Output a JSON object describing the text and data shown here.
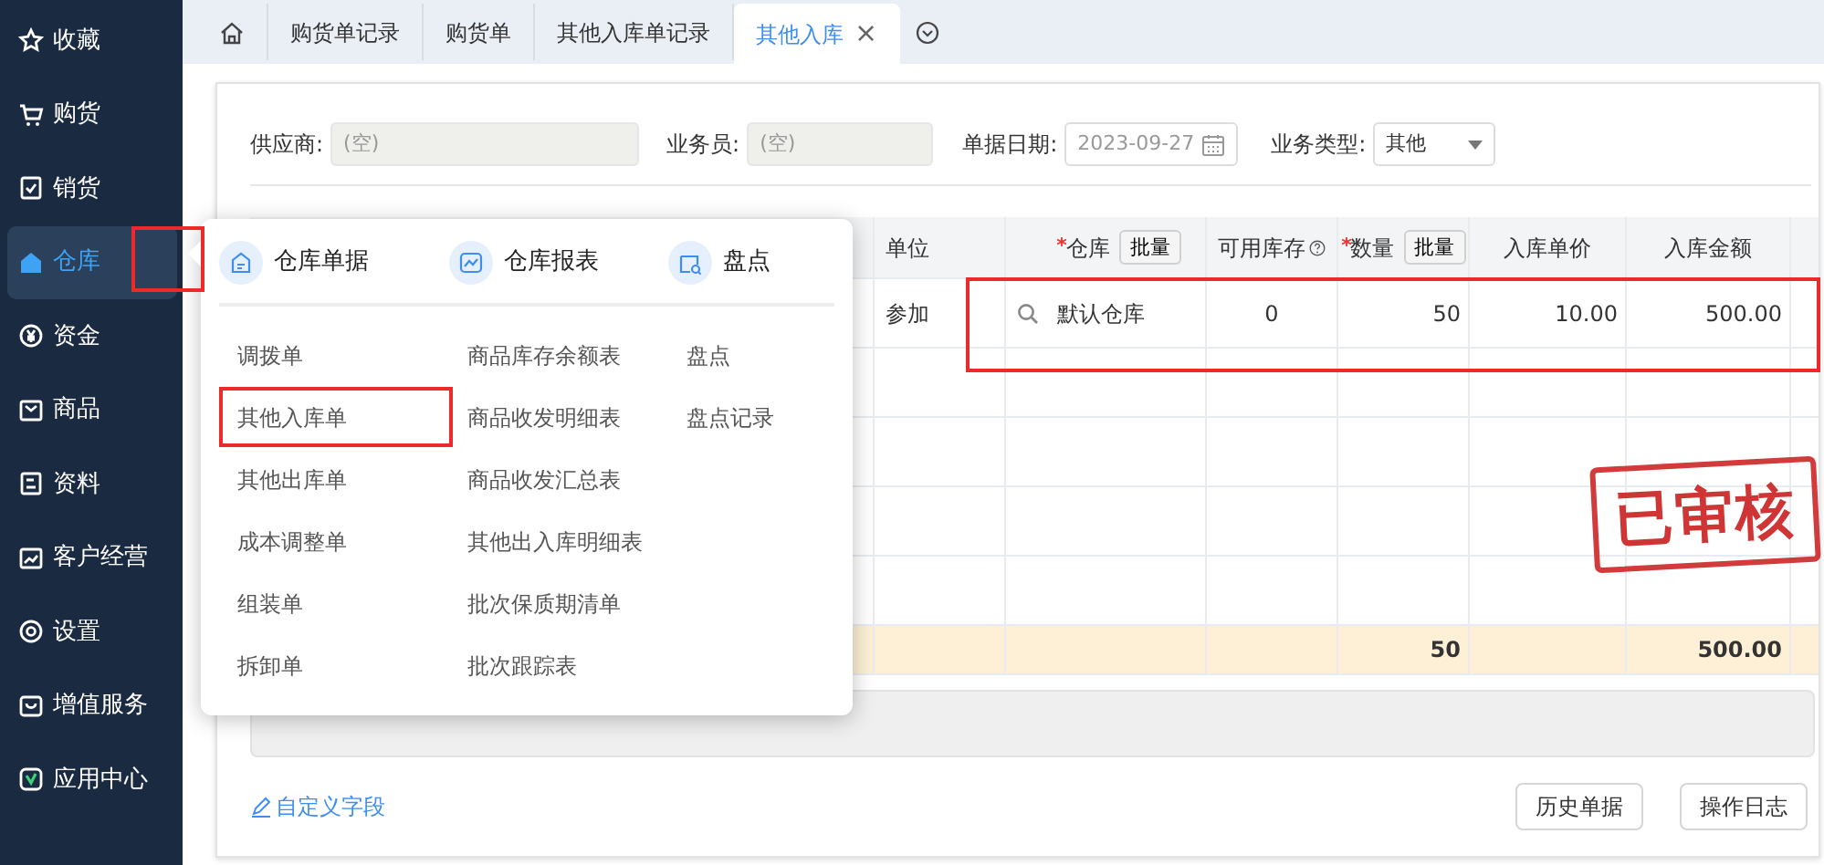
{
  "sidebar": {
    "items": [
      {
        "label": "收藏",
        "selected": false,
        "annotated": false
      },
      {
        "label": "购货",
        "selected": false,
        "annotated": false
      },
      {
        "label": "销货",
        "selected": false,
        "annotated": false
      },
      {
        "label": "仓库",
        "selected": true,
        "annotated": true
      },
      {
        "label": "资金",
        "selected": false,
        "annotated": false
      },
      {
        "label": "商品",
        "selected": false,
        "annotated": false
      },
      {
        "label": "资料",
        "selected": false,
        "annotated": false
      },
      {
        "label": "客户经营",
        "selected": false,
        "annotated": false
      },
      {
        "label": "设置",
        "selected": false,
        "annotated": false
      },
      {
        "label": "增值服务",
        "selected": false,
        "annotated": false
      },
      {
        "label": "应用中心",
        "selected": false,
        "annotated": false
      }
    ]
  },
  "tabs": [
    {
      "label": "购货单记录",
      "selected": false,
      "closable": false
    },
    {
      "label": "购货单",
      "selected": false,
      "closable": false
    },
    {
      "label": "其他入库单记录",
      "selected": false,
      "closable": false
    },
    {
      "label": "其他入库",
      "selected": true,
      "closable": true
    }
  ],
  "tab_close": "×",
  "form": {
    "fields": [
      {
        "kind": "text",
        "label": "供应商:",
        "placeholder": "(空)",
        "disabled": true
      },
      {
        "kind": "text",
        "label": "业务员:",
        "placeholder": "(空)",
        "disabled": true
      },
      {
        "kind": "date",
        "label": "单据日期:",
        "placeholder": "2023-09-27",
        "disabled": false
      },
      {
        "kind": "select",
        "label": "业务类型:",
        "value": "其他",
        "disabled": false
      }
    ]
  },
  "table": {
    "columns": [
      {
        "label": "单位",
        "required": false,
        "help": false
      },
      {
        "label": "仓库",
        "required": true,
        "button": "批量",
        "help": false
      },
      {
        "label": "可用库存",
        "required": false,
        "help": true
      },
      {
        "label": "数量",
        "required": true,
        "button": "批量",
        "help": false,
        "total": "50"
      },
      {
        "label": "入库单价",
        "required": false,
        "help": false
      },
      {
        "label": "入库金额",
        "required": false,
        "help": false,
        "total": "500.00"
      }
    ],
    "rows": [
      {
        "annotated": true,
        "cells": [
          "参加",
          "默认仓库",
          "0",
          "50",
          "10.00",
          "500.00"
        ]
      }
    ]
  },
  "stamp": "已审核",
  "custom_fields_link": "自定义字段",
  "buttons": [
    "历史单据",
    "操作日志"
  ],
  "menu": {
    "groups": [
      {
        "title": "仓库单据",
        "items": [
          {
            "label": "调拨单",
            "annotated": false
          },
          {
            "label": "其他入库单",
            "annotated": true
          },
          {
            "label": "其他出库单",
            "annotated": false
          },
          {
            "label": "成本调整单",
            "annotated": false
          },
          {
            "label": "组装单",
            "annotated": false
          },
          {
            "label": "拆卸单",
            "annotated": false
          }
        ]
      },
      {
        "title": "仓库报表",
        "items": [
          {
            "label": "商品库存余额表",
            "annotated": false
          },
          {
            "label": "商品收发明细表",
            "annotated": false
          },
          {
            "label": "商品收发汇总表",
            "annotated": false
          },
          {
            "label": "其他出入库明细表",
            "annotated": false
          },
          {
            "label": "批次保质期清单",
            "annotated": false
          },
          {
            "label": "批次跟踪表",
            "annotated": false
          }
        ]
      },
      {
        "title": "盘点",
        "items": [
          {
            "label": "盘点",
            "annotated": false
          },
          {
            "label": "盘点记录",
            "annotated": false
          }
        ]
      }
    ]
  }
}
